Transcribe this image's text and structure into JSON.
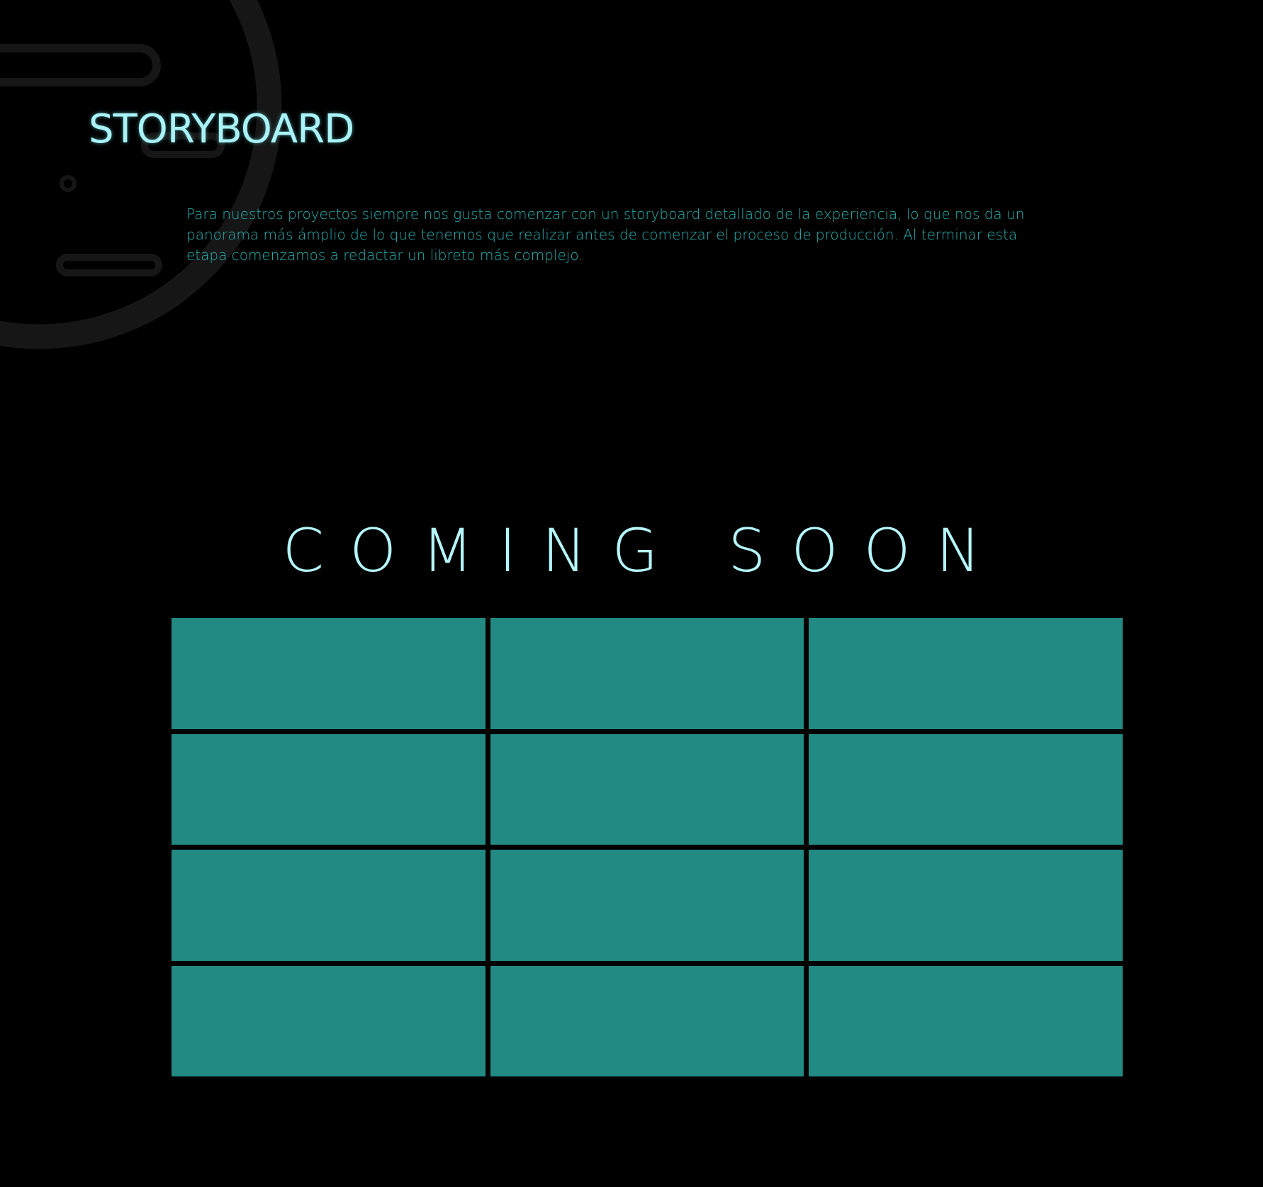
{
  "page": {
    "title": "STORYBOARD",
    "intro_text": "Para nuestros proyectos siempre nos gusta comenzar con un storyboard detallado de la experiencia, lo que nos da un panorama más ámplio de lo que tenemos que realizar antes de comenzar el proceso de producción. Al terminar esta etapa comenzamos a redactar un libreto más complejo.",
    "coming_soon": "COMING SOON"
  },
  "storyboard": {
    "frame_count": 12,
    "columns": 3,
    "rows": 4
  },
  "colors": {
    "background": "#000000",
    "title": "#a9f3f7",
    "body_text": "#25b0b0",
    "coming_soon": "#b4f6fa",
    "frame_fill": "#228a82",
    "decoration_stroke": "#161616"
  },
  "icons": {
    "background": "storyboard-outline-icon"
  }
}
